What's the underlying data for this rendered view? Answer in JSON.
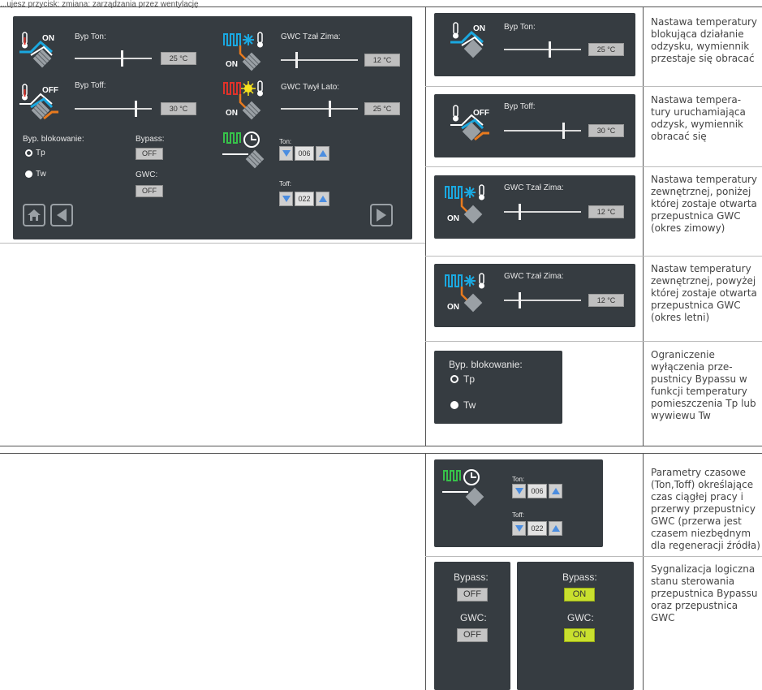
{
  "header": "...ujesz przycisk: zmiana: zarządzania przez wentylację",
  "main_panel": {
    "byp_ton": {
      "state": "ON",
      "label": "Byp Ton:",
      "value": "25 °C",
      "level": 0.62
    },
    "byp_toff": {
      "state": "OFF",
      "label": "Byp Toff:",
      "value": "30 °C",
      "level": 0.8
    },
    "gwc_zima": {
      "state": "ON",
      "label": "GWC Tzał Zima:",
      "value": "12 °C",
      "level": 0.22
    },
    "gwc_lato": {
      "state": "ON",
      "label": "GWC Twył Lato:",
      "value": "25 °C",
      "level": 0.62
    },
    "blok_label": "Byp. blokowanie:",
    "opt_tp": "Tp",
    "opt_tw": "Tw",
    "bypass_label": "Bypass:",
    "bypass_value": "OFF",
    "gwc_label": "GWC:",
    "gwc_value": "OFF",
    "ton_label": "Ton:",
    "ton_value": "006",
    "toff_label": "Toff:",
    "toff_value": "022"
  },
  "rows": [
    {
      "label": "Byp Ton:",
      "state": "ON",
      "value": "25 °C",
      "desc": "Nastawa temperatury blokująca działanie odzysku, wymiennik przestaje się obracać"
    },
    {
      "label": "Byp Toff:",
      "state": "OFF",
      "value": "30 °C",
      "desc": "Nastawa tempera-tury uruchamiająca odzysk, wymiennik obracać się"
    },
    {
      "label": "GWC Tzał Zima:",
      "state": "ON",
      "value": "12 °C",
      "desc": "Nastawa temperatury zewnętrznej, poniżej której zostaje otwarta przepustnica GWC (okres zimowy)"
    },
    {
      "label": "GWC Tzał Zima:",
      "state": "ON",
      "value": "12 °C",
      "desc": "Nastaw temperatury zewnętrznej, powyżej której zostaje otwarta przepustnica GWC (okres letni)"
    },
    {
      "label": "Byp. blokowanie:",
      "opt1": "Tp",
      "opt2": "Tw",
      "desc": "Ograniczenie wyłączenia prze-pustnicy Bypassu w funkcji temperatury pomieszczenia Tp lub wywiewu Tw"
    }
  ],
  "time_row": {
    "ton_label": "Ton:",
    "ton_value": "006",
    "toff_label": "Toff:",
    "toff_value": "022",
    "desc": "Parametry czasowe (Ton,Toff) określające czas ciągłej pracy i przerwy przepustnicy GWC (przerwa jest czasem niezbędnym dla regeneracji źródła)"
  },
  "status_row": {
    "off": {
      "bypass_label": "Bypass:",
      "bypass_value": "OFF",
      "gwc_label": "GWC:",
      "gwc_value": "OFF"
    },
    "on": {
      "bypass_label": "Bypass:",
      "bypass_value": "ON",
      "gwc_label": "GWC:",
      "gwc_value": "ON"
    },
    "desc": "Sygnalizacja logiczna stanu sterowania przepustnica Bypassu oraz przepustnica GWC"
  },
  "colors": {
    "panel": "#363c41",
    "on_green": "#c9e02e",
    "snow_blue": "#1aa8e0",
    "sun_yellow": "#f5e11e",
    "wave_red": "#e0322a",
    "wave_green": "#37c24a",
    "pipe_orange": "#e87a1e"
  }
}
